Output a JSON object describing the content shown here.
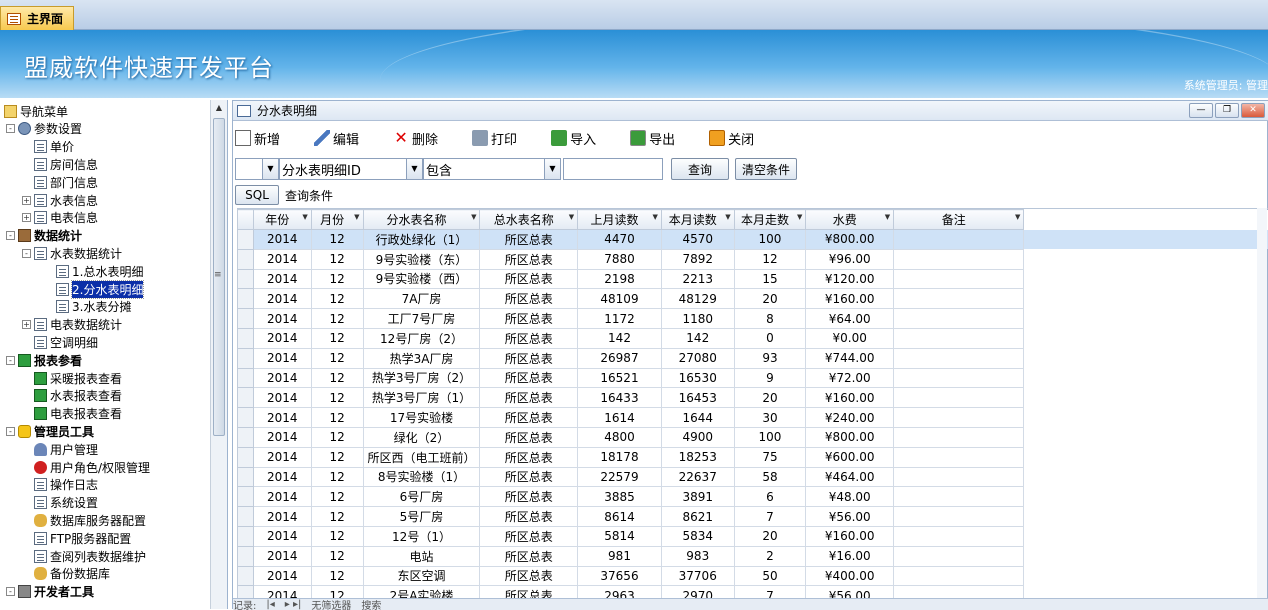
{
  "tab": {
    "label": "主界面"
  },
  "banner": {
    "title": "盟威软件快速开发平台",
    "user": "系统管理员: 管理"
  },
  "nav": {
    "items": [
      {
        "label": "导航菜单",
        "indent": 0,
        "icon": "folder-icon",
        "exp": ""
      },
      {
        "label": "参数设置",
        "indent": 1,
        "icon": "gear-icon",
        "exp": "-"
      },
      {
        "label": "单价",
        "indent": 2,
        "icon": "doc-icon",
        "exp": ""
      },
      {
        "label": "房间信息",
        "indent": 2,
        "icon": "doc-icon",
        "exp": ""
      },
      {
        "label": "部门信息",
        "indent": 2,
        "icon": "doc-icon",
        "exp": ""
      },
      {
        "label": "水表信息",
        "indent": 2,
        "icon": "doc-icon",
        "exp": "+"
      },
      {
        "label": "电表信息",
        "indent": 2,
        "icon": "doc-icon",
        "exp": "+"
      },
      {
        "label": "数据统计",
        "indent": 1,
        "icon": "chart-icon",
        "exp": "-"
      },
      {
        "label": "水表数据统计",
        "indent": 2,
        "icon": "doc-icon",
        "exp": "-"
      },
      {
        "label": "1.总水表明细",
        "indent": 3,
        "icon": "doc-icon",
        "exp": ""
      },
      {
        "label": "2.分水表明细",
        "indent": 3,
        "icon": "doc-icon",
        "exp": "",
        "selected": true
      },
      {
        "label": "3.水表分摊",
        "indent": 3,
        "icon": "doc-icon",
        "exp": ""
      },
      {
        "label": "电表数据统计",
        "indent": 2,
        "icon": "doc-icon",
        "exp": "+"
      },
      {
        "label": "空调明细",
        "indent": 2,
        "icon": "doc-icon",
        "exp": ""
      },
      {
        "label": "报表参看",
        "indent": 1,
        "icon": "green-icon",
        "exp": "-"
      },
      {
        "label": "采暖报表查看",
        "indent": 2,
        "icon": "green-icon",
        "exp": ""
      },
      {
        "label": "水表报表查看",
        "indent": 2,
        "icon": "green-icon",
        "exp": ""
      },
      {
        "label": "电表报表查看",
        "indent": 2,
        "icon": "green-icon",
        "exp": ""
      },
      {
        "label": "管理员工具",
        "indent": 1,
        "icon": "star-icon",
        "exp": "-"
      },
      {
        "label": "用户管理",
        "indent": 2,
        "icon": "users-icon",
        "exp": ""
      },
      {
        "label": "用户角色/权限管理",
        "indent": 2,
        "icon": "stop-icon",
        "exp": ""
      },
      {
        "label": "操作日志",
        "indent": 2,
        "icon": "doc-icon",
        "exp": ""
      },
      {
        "label": "系统设置",
        "indent": 2,
        "icon": "doc-icon",
        "exp": ""
      },
      {
        "label": "数据库服务器配置",
        "indent": 2,
        "icon": "db-icon",
        "exp": ""
      },
      {
        "label": "FTP服务器配置",
        "indent": 2,
        "icon": "doc-icon",
        "exp": ""
      },
      {
        "label": "查阅列表数据维护",
        "indent": 2,
        "icon": "doc-icon",
        "exp": ""
      },
      {
        "label": "备份数据库",
        "indent": 2,
        "icon": "db-icon",
        "exp": ""
      },
      {
        "label": "开发者工具",
        "indent": 1,
        "icon": "tools-icon",
        "exp": "-"
      }
    ]
  },
  "window": {
    "title": "分水表明细"
  },
  "toolbar": {
    "new": "新增",
    "edit": "编辑",
    "delete": "删除",
    "print": "打印",
    "import": "导入",
    "export": "导出",
    "close": "关闭"
  },
  "filter": {
    "field": "分水表明细ID",
    "op": "包含",
    "value": "",
    "query": "查询",
    "clear": "清空条件"
  },
  "sql": {
    "button": "SQL",
    "label": "查询条件"
  },
  "grid": {
    "columns": [
      "年份",
      "月份",
      "分水表名称",
      "总水表名称",
      "上月读数",
      "本月读数",
      "本月走数",
      "水费",
      "备注"
    ],
    "rows": [
      [
        "2014",
        "12",
        "行政处绿化（1）",
        "所区总表",
        "4470",
        "4570",
        "100",
        "¥800.00",
        ""
      ],
      [
        "2014",
        "12",
        "9号实验楼（东）",
        "所区总表",
        "7880",
        "7892",
        "12",
        "¥96.00",
        ""
      ],
      [
        "2014",
        "12",
        "9号实验楼（西）",
        "所区总表",
        "2198",
        "2213",
        "15",
        "¥120.00",
        ""
      ],
      [
        "2014",
        "12",
        "7A厂房",
        "所区总表",
        "48109",
        "48129",
        "20",
        "¥160.00",
        ""
      ],
      [
        "2014",
        "12",
        "工厂7号厂房",
        "所区总表",
        "1172",
        "1180",
        "8",
        "¥64.00",
        ""
      ],
      [
        "2014",
        "12",
        "12号厂房（2）",
        "所区总表",
        "142",
        "142",
        "0",
        "¥0.00",
        ""
      ],
      [
        "2014",
        "12",
        "热学3A厂房",
        "所区总表",
        "26987",
        "27080",
        "93",
        "¥744.00",
        ""
      ],
      [
        "2014",
        "12",
        "热学3号厂房（2）",
        "所区总表",
        "16521",
        "16530",
        "9",
        "¥72.00",
        ""
      ],
      [
        "2014",
        "12",
        "热学3号厂房（1）",
        "所区总表",
        "16433",
        "16453",
        "20",
        "¥160.00",
        ""
      ],
      [
        "2014",
        "12",
        "17号实验楼",
        "所区总表",
        "1614",
        "1644",
        "30",
        "¥240.00",
        ""
      ],
      [
        "2014",
        "12",
        "绿化（2）",
        "所区总表",
        "4800",
        "4900",
        "100",
        "¥800.00",
        ""
      ],
      [
        "2014",
        "12",
        "所区西（电工班前）",
        "所区总表",
        "18178",
        "18253",
        "75",
        "¥600.00",
        ""
      ],
      [
        "2014",
        "12",
        "8号实验楼（1）",
        "所区总表",
        "22579",
        "22637",
        "58",
        "¥464.00",
        ""
      ],
      [
        "2014",
        "12",
        "6号厂房",
        "所区总表",
        "3885",
        "3891",
        "6",
        "¥48.00",
        ""
      ],
      [
        "2014",
        "12",
        "5号厂房",
        "所区总表",
        "8614",
        "8621",
        "7",
        "¥56.00",
        ""
      ],
      [
        "2014",
        "12",
        "12号（1）",
        "所区总表",
        "5814",
        "5834",
        "20",
        "¥160.00",
        ""
      ],
      [
        "2014",
        "12",
        "电站",
        "所区总表",
        "981",
        "983",
        "2",
        "¥16.00",
        ""
      ],
      [
        "2014",
        "12",
        "东区空调",
        "所区总表",
        "37656",
        "37706",
        "50",
        "¥400.00",
        ""
      ],
      [
        "2014",
        "12",
        "2号A实验楼",
        "所区总表",
        "2963",
        "2970",
        "7",
        "¥56.00",
        ""
      ]
    ]
  },
  "status": {
    "record": "记录:",
    "filter": "无筛选器",
    "search": "搜索"
  }
}
